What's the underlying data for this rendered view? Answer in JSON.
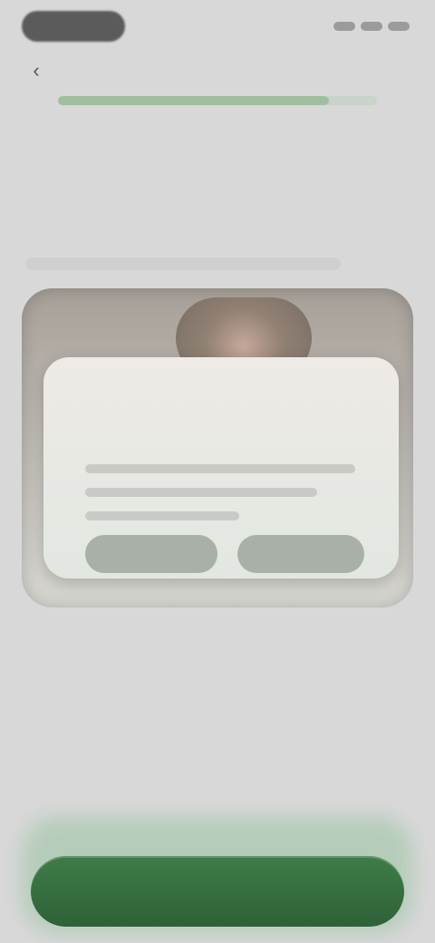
{
  "status_bar": {
    "icons": [
      "signal-icon",
      "wifi-icon",
      "battery-icon"
    ]
  },
  "header": {
    "title": "",
    "progress_percent": 85,
    "back_icon": "chevron-left-icon"
  },
  "question": {
    "text": "",
    "caption": ""
  },
  "illustration": {
    "dialog_title": "",
    "primary_button": "",
    "secondary_button": ""
  },
  "footer": {
    "cta_label": ""
  },
  "colors": {
    "accent": "#2f6b39",
    "background": "#d8d8d8",
    "progress_track": "#c9d3c9",
    "progress_fill": "#9fbf9f"
  }
}
